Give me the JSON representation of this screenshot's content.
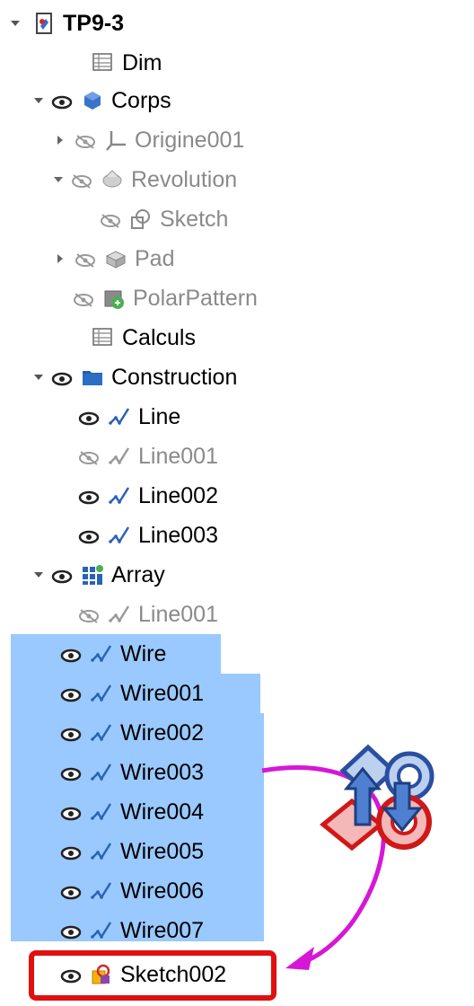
{
  "tree": {
    "root": {
      "label": "TP9-3"
    },
    "items": [
      {
        "key": "dim",
        "label": "Dim",
        "muted": false
      },
      {
        "key": "corps",
        "label": "Corps",
        "muted": false
      },
      {
        "key": "origine001",
        "label": "Origine001",
        "muted": true
      },
      {
        "key": "revolution",
        "label": "Revolution",
        "muted": true
      },
      {
        "key": "sketch",
        "label": "Sketch",
        "muted": true
      },
      {
        "key": "pad",
        "label": "Pad",
        "muted": true
      },
      {
        "key": "polarpattern",
        "label": "PolarPattern",
        "muted": true
      },
      {
        "key": "calculs",
        "label": "Calculs",
        "muted": false
      },
      {
        "key": "construction",
        "label": "Construction",
        "muted": false
      },
      {
        "key": "line",
        "label": "Line",
        "muted": false
      },
      {
        "key": "line001",
        "label": "Line001",
        "muted": true
      },
      {
        "key": "line002",
        "label": "Line002",
        "muted": false
      },
      {
        "key": "line003",
        "label": "Line003",
        "muted": false
      },
      {
        "key": "array",
        "label": "Array",
        "muted": false
      },
      {
        "key": "array-line001",
        "label": "Line001",
        "muted": true
      },
      {
        "key": "wire",
        "label": "Wire",
        "muted": false,
        "selected": true
      },
      {
        "key": "wire001",
        "label": "Wire001",
        "muted": false,
        "selected": true
      },
      {
        "key": "wire002",
        "label": "Wire002",
        "muted": false,
        "selected": true
      },
      {
        "key": "wire003",
        "label": "Wire003",
        "muted": false,
        "selected": true
      },
      {
        "key": "wire004",
        "label": "Wire004",
        "muted": false,
        "selected": true
      },
      {
        "key": "wire005",
        "label": "Wire005",
        "muted": false,
        "selected": true
      },
      {
        "key": "wire006",
        "label": "Wire006",
        "muted": false,
        "selected": true
      },
      {
        "key": "wire007",
        "label": "Wire007",
        "muted": false,
        "selected": true
      },
      {
        "key": "sketch002",
        "label": "Sketch002",
        "muted": false,
        "highlighted": true
      }
    ]
  },
  "icons": {
    "visible": "eye-icon",
    "hidden": "eye-hidden-icon",
    "spreadsheet": "spreadsheet-icon",
    "body": "body-icon",
    "origin": "origin-icon",
    "revolution": "revolution-icon",
    "sketch": "sketch-icon",
    "pad": "pad-icon",
    "polarpattern": "polar-pattern-icon",
    "folder": "folder-icon",
    "line": "draft-line-icon",
    "array": "array-icon",
    "sketch_attached": "sketch-attached-icon",
    "move_to_sketch": "draft-to-sketch-icon"
  },
  "colors": {
    "selection": "#99c9ff",
    "muted_text": "#8a8a8a",
    "callout_arrow": "#d617d6",
    "highlight_box": "#e01010"
  }
}
